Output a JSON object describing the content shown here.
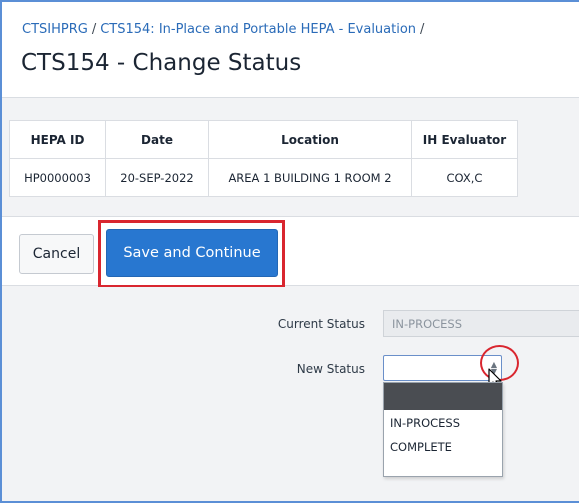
{
  "breadcrumb": {
    "items": [
      "CTSIHPRG",
      "CTS154: In-Place and Portable HEPA - Evaluation"
    ],
    "separator": "/"
  },
  "page": {
    "title": "CTS154 - Change Status"
  },
  "table": {
    "headers": [
      "HEPA ID",
      "Date",
      "Location",
      "IH Evaluator"
    ],
    "rows": [
      [
        "HP0000003",
        "20-SEP-2022",
        "AREA 1 BUILDING 1 ROOM 2",
        "COX,C"
      ]
    ]
  },
  "actions": {
    "cancel_label": "Cancel",
    "save_label": "Save and Continue"
  },
  "form": {
    "current_status_label": "Current Status",
    "current_status_value": "IN-PROCESS",
    "new_status_label": "New Status",
    "new_status_value": "",
    "new_status_options": [
      "",
      "IN-PROCESS",
      "COMPLETE"
    ]
  },
  "colors": {
    "accent": "#2877d0",
    "annotation": "#d9262f",
    "link": "#2a6bb8"
  }
}
